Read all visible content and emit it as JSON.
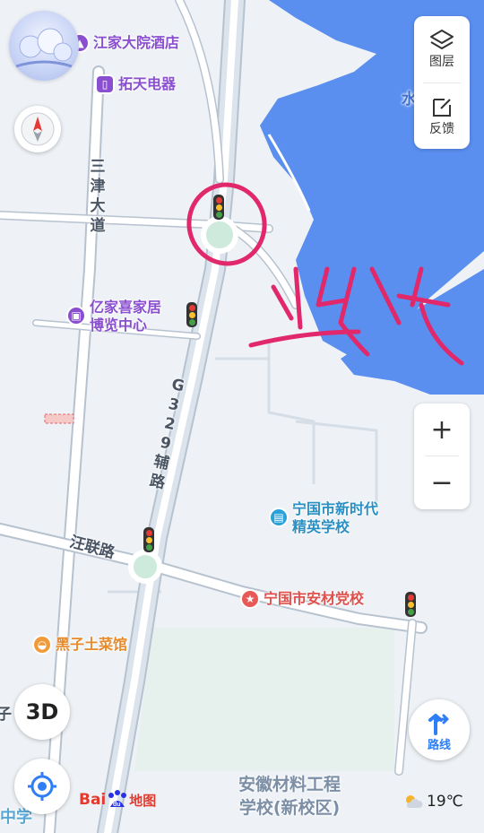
{
  "pois": {
    "hotel": "江家大院酒店",
    "electric": "拓天电器",
    "furniture_line1": "亿家喜家居",
    "furniture_line2": "博览中心",
    "school_line1": "宁国市新时代",
    "school_line2": "精英学校",
    "party_school": "宁国市安材党校",
    "restaurant": "黑子土菜馆",
    "college_line1": "安徽材料工程",
    "college_line2": "学校(新校区)",
    "middle_school": "中学"
  },
  "roads": {
    "sanjin_chars": [
      "三",
      "津",
      "大",
      "道"
    ],
    "g329_chars": [
      "G",
      "3",
      "2",
      "9",
      "辅",
      "路"
    ],
    "wanglian": "汪联路",
    "left_edge": "子",
    "river_edge": "水"
  },
  "controls": {
    "layers_label": "图层",
    "feedback_label": "反馈",
    "zoom_in": "+",
    "zoom_out": "−",
    "view_3d": "3D",
    "route_label": "路线"
  },
  "brand": {
    "logo_text": "Bai",
    "logo_map": "地图"
  },
  "weather": {
    "temperature": "19℃",
    "icon": "cloudy-sun-icon"
  },
  "annotation": {
    "handwritten_text": "此处",
    "color": "#e0286b"
  },
  "colors": {
    "water": "#5a8ff0",
    "road": "#ffffff",
    "land": "#eef2f6",
    "poi_purple": "#8a4fd0",
    "poi_blue": "#2aa2d8",
    "poi_red": "#e85a57",
    "poi_orange": "#f19a3a"
  }
}
